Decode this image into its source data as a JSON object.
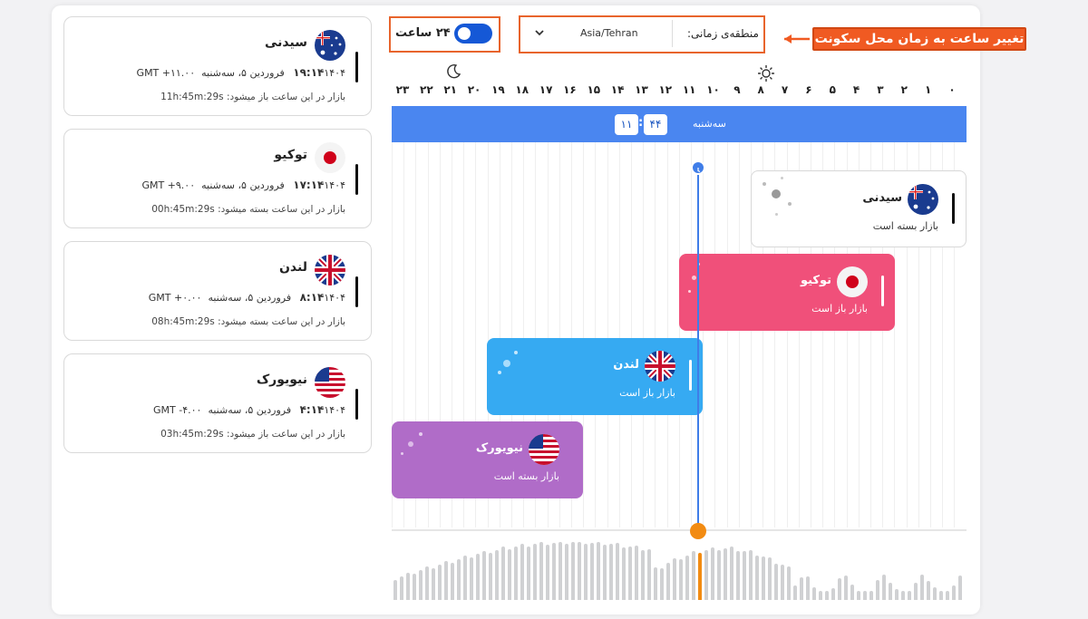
{
  "controls": {
    "hour24_label": "۲۴ ساعت",
    "hour24_on": true,
    "timezone_label": "منطقه‌ی زمانی:",
    "timezone_value": "Asia/Tehran",
    "callout": "تغییر ساعت به زمان محل سکونت"
  },
  "colors": {
    "accent": "#e8642c",
    "timeline": "#4a86f0",
    "tokyo": "#f0507a",
    "london": "#36aaf2",
    "newyork": "#b06cc8"
  },
  "cards": [
    {
      "id": "sydney",
      "name": "سیدنی",
      "time": "۱۹:۱۴",
      "date": "۱۴۰۴ فروردین ۵، سه‌شنبه",
      "gmt": "GMT +۱۱.۰۰",
      "note": "بازار در این ساعت باز میشود: 11h:45m:29s",
      "flag_icon": "australia-flag-icon"
    },
    {
      "id": "tokyo",
      "name": "توکیو",
      "time": "۱۷:۱۴",
      "date": "۱۴۰۴ فروردین ۵، سه‌شنبه",
      "gmt": "GMT +۹.۰۰",
      "note": "بازار در این ساعت بسته میشود: 00h:45m:29s",
      "flag_icon": "japan-flag-icon"
    },
    {
      "id": "london",
      "name": "لندن",
      "time": "۸:۱۴",
      "date": "۱۴۰۴ فروردین ۵، سه‌شنبه",
      "gmt": "GMT +۰.۰۰",
      "note": "بازار در این ساعت بسته میشود: 08h:45m:29s",
      "flag_icon": "uk-flag-icon"
    },
    {
      "id": "newyork",
      "name": "نیویورک",
      "time": "۴:۱۴",
      "date": "۱۴۰۴ فروردین ۵، سه‌شنبه",
      "gmt": "GMT -۴.۰۰",
      "note": "بازار در این ساعت باز میشود: 03h:45m:29s",
      "flag_icon": "usa-flag-icon"
    }
  ],
  "timeline": {
    "hours": [
      "۰",
      "۱",
      "۲",
      "۳",
      "۴",
      "۵",
      "۶",
      "۷",
      "۸",
      "۹",
      "۱۰",
      "۱۱",
      "۱۲",
      "۱۳",
      "۱۴",
      "۱۵",
      "۱۶",
      "۱۷",
      "۱۸",
      "۱۹",
      "۲۰",
      "۲۱",
      "۲۲",
      "۲۳"
    ],
    "day_name": "سه‌شنبه",
    "now_hour": "۱۱",
    "now_minute": "۴۴",
    "sun_icon": "sun-icon",
    "moon_icon": "moon-icon"
  },
  "markets": [
    {
      "id": "sydney",
      "name": "سیدنی",
      "status": "بازار بسته است"
    },
    {
      "id": "tokyo",
      "name": "توکیو",
      "status": "بازار باز است"
    },
    {
      "id": "london",
      "name": "لندن",
      "status": "بازار باز است"
    },
    {
      "id": "newyork",
      "name": "نیویورک",
      "status": "بازار بسته است"
    }
  ]
}
